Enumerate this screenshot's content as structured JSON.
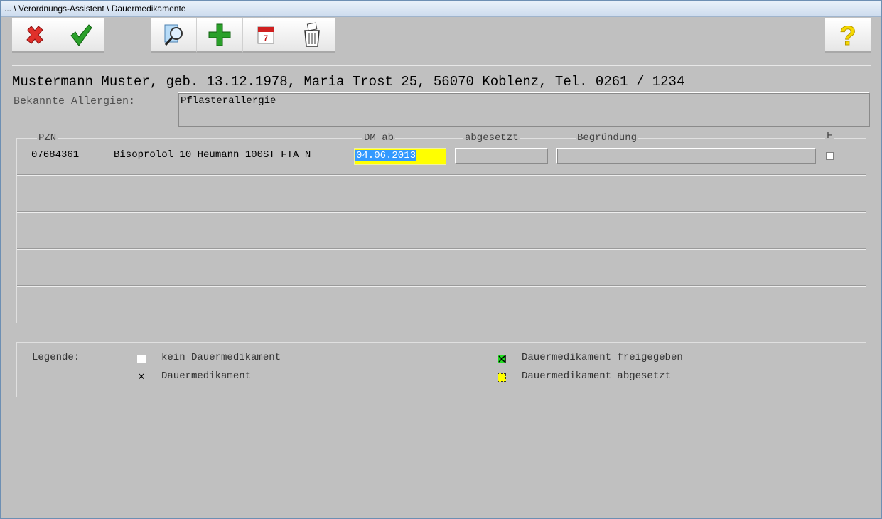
{
  "window": {
    "title": "... \\ Verordnungs-Assistent \\ Dauermedikamente"
  },
  "toolbar": {
    "cancel_icon": "red-x-icon",
    "confirm_icon": "green-check-icon",
    "search_icon": "magnifier-icon",
    "add_icon": "green-plus-icon",
    "calendar_icon": "calendar-icon",
    "calendar_day": "7",
    "delete_icon": "trash-can-icon",
    "help_icon": "yellow-question-icon",
    "help_glyph": "?"
  },
  "patient": {
    "line": "Mustermann Muster, geb. 13.12.1978, Maria Trost 25, 56070 Koblenz, Tel. 0261 / 1234"
  },
  "allergies": {
    "label": "Bekannte Allergien:",
    "value": "Pflasterallergie"
  },
  "table": {
    "columns": {
      "pzn": "PZN",
      "dm_ab": "DM ab",
      "abgesetzt": "abgesetzt",
      "begruendung": "Begründung",
      "f": "F"
    },
    "rows": [
      {
        "pzn": "07684361",
        "name": "Bisoprolol 10 Heumann 100ST FTA N",
        "dm_ab": "04.06.2013",
        "abgesetzt": "",
        "begruendung": "",
        "f": false
      }
    ]
  },
  "legend": {
    "title": "Legende:",
    "items": [
      {
        "label": "kein Dauermedikament",
        "symbol": "white-square"
      },
      {
        "label": "Dauermedikament",
        "symbol": "black-x",
        "glyph": "✕"
      },
      {
        "label": "Dauermedikament freigegeben",
        "symbol": "green-square-x"
      },
      {
        "label": "Dauermedikament abgesetzt",
        "symbol": "yellow-square-dotted"
      }
    ]
  },
  "colors": {
    "background": "#c0c0c0",
    "highlight": "#ffff00",
    "selection": "#3399ff"
  }
}
